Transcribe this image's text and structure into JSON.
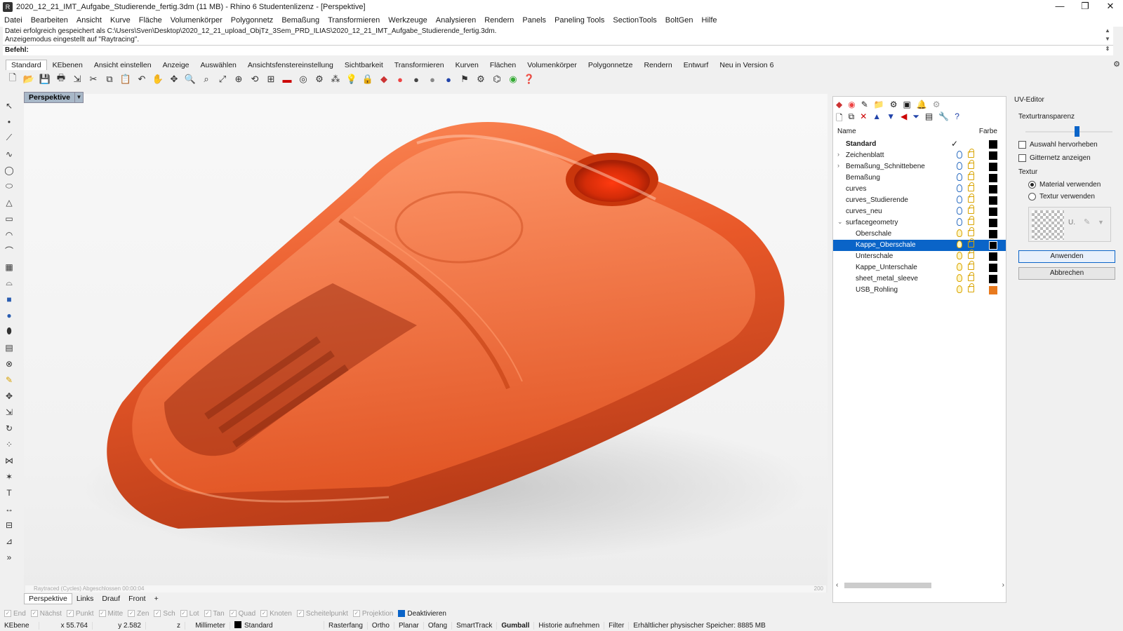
{
  "window": {
    "title": "2020_12_21_IMT_Aufgabe_Studierende_fertig.3dm (11 MB) - Rhino 6 Studentenlizenz - [Perspektive]",
    "minimize": "—",
    "maximize": "❐",
    "close": "✕"
  },
  "menu": [
    "Datei",
    "Bearbeiten",
    "Ansicht",
    "Kurve",
    "Fläche",
    "Volumenkörper",
    "Polygonnetz",
    "Bemaßung",
    "Transformieren",
    "Werkzeuge",
    "Analysieren",
    "Rendern",
    "Panels",
    "Paneling Tools",
    "SectionTools",
    "BoltGen",
    "Hilfe"
  ],
  "command": {
    "history_1": "Datei erfolgreich gespeichert als C:\\Users\\Sven\\Desktop\\2020_12_21_upload_ObjTz_3Sem_PRD_ILIAS\\2020_12_21_IMT_Aufgabe_Studierende_fertig.3dm.",
    "history_2": "Anzeigemodus eingestellt auf \"Raytracing\".",
    "prompt": "Befehl:"
  },
  "toolbar_tabs": [
    "Standard",
    "KEbenen",
    "Ansicht einstellen",
    "Anzeige",
    "Auswählen",
    "Ansichtsfenstereinstellung",
    "Sichtbarkeit",
    "Transformieren",
    "Kurven",
    "Flächen",
    "Volumenkörper",
    "Polygonnetze",
    "Rendern",
    "Entwurf",
    "Neu in Version 6"
  ],
  "viewport": {
    "name": "Perspektive",
    "status_left": "Raytraced (Cycles)   Abgeschlossen   00:00:04",
    "status_right": "200",
    "tabs": [
      "Perspektive",
      "Links",
      "Drauf",
      "Front"
    ],
    "add_tab": "+"
  },
  "layers": {
    "col_name": "Name",
    "col_color": "Farbe",
    "rows": [
      {
        "name": "Standard",
        "bold": true,
        "current": true,
        "color": "#000000"
      },
      {
        "name": "Zeichenblatt",
        "expand": true,
        "color": "#000000"
      },
      {
        "name": "Bemaßung_Schnittebene",
        "expand": true,
        "color": "#000000"
      },
      {
        "name": "Bemaßung",
        "color": "#000000"
      },
      {
        "name": "curves",
        "color": "#000000"
      },
      {
        "name": "curves_Studierende",
        "color": "#000000"
      },
      {
        "name": "curves_neu",
        "color": "#000000"
      },
      {
        "name": "surfacegeometry",
        "expanded": true,
        "color": "#000000"
      },
      {
        "name": "Oberschale",
        "child": true,
        "color": "#000000"
      },
      {
        "name": "Kappe_Oberschale",
        "child": true,
        "selected": true,
        "color": "#000000"
      },
      {
        "name": "Unterschale",
        "child": true,
        "color": "#000000"
      },
      {
        "name": "Kappe_Unterschale",
        "child": true,
        "color": "#000000"
      },
      {
        "name": "sheet_metal_sleeve",
        "child": true,
        "color": "#000000"
      },
      {
        "name": "USB_Rohling",
        "child": true,
        "color": "#e87a1e"
      }
    ]
  },
  "uv_editor": {
    "title": "UV-Editor",
    "transparency_label": "Texturtransparenz",
    "transparency_level": 0.6,
    "highlight_label": "Auswahl hervorheben",
    "mesh_label": "Gitternetz anzeigen",
    "texture_label": "Textur",
    "use_material": "Material verwenden",
    "use_texture": "Textur verwenden",
    "tex_u": "U.",
    "apply": "Anwenden",
    "cancel": "Abbrechen"
  },
  "osnaps": [
    {
      "label": "End",
      "on": false
    },
    {
      "label": "Nächst",
      "on": false
    },
    {
      "label": "Punkt",
      "on": false
    },
    {
      "label": "Mitte",
      "on": false
    },
    {
      "label": "Zen",
      "on": false
    },
    {
      "label": "Sch",
      "on": false
    },
    {
      "label": "Lot",
      "on": false
    },
    {
      "label": "Tan",
      "on": false
    },
    {
      "label": "Quad",
      "on": false
    },
    {
      "label": "Knoten",
      "on": false
    },
    {
      "label": "Scheitelpunkt",
      "on": false
    },
    {
      "label": "Projektion",
      "on": false
    },
    {
      "label": "Deaktivieren",
      "on": true
    }
  ],
  "status": {
    "cplane": "KEbene",
    "x": "x 55.764",
    "y": "y 2.582",
    "z": "z",
    "units": "Millimeter",
    "layer": "Standard",
    "grid": "Rasterfang",
    "ortho": "Ortho",
    "planar": "Planar",
    "osnap": "Ofang",
    "smarttrack": "SmartTrack",
    "gumball": "Gumball",
    "history": "Historie aufnehmen",
    "filter": "Filter",
    "memory": "Erhältlicher physischer Speicher: 8885 MB"
  },
  "colors": {
    "accent": "#0a64c8",
    "model_orange": "#e8501e"
  }
}
